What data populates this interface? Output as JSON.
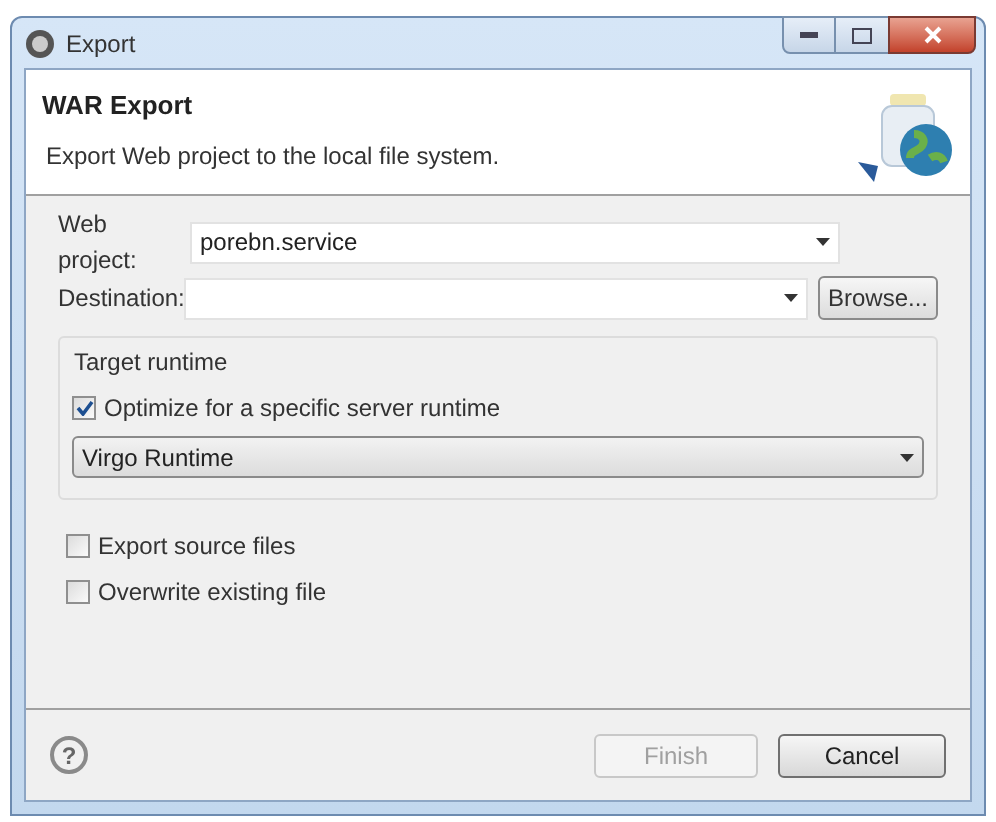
{
  "window": {
    "title": "Export"
  },
  "header": {
    "title": "WAR Export",
    "description": "Export Web project to the local file system."
  },
  "fields": [
    {
      "label": "Web project:",
      "value": "porebn.service"
    },
    {
      "label": "Destination:",
      "button": "Browse..."
    }
  ],
  "target_runtime": {
    "title": "Target runtime",
    "optimize": {
      "label": "Optimize for a specific server runtime",
      "checked": true
    },
    "runtime": "Virgo Runtime"
  },
  "options": [
    {
      "label": "Export source files",
      "checked": false
    },
    {
      "label": "Overwrite existing file",
      "checked": false
    }
  ],
  "help": "?",
  "buttons": [
    {
      "label": "Finish",
      "disabled": true
    },
    {
      "label": "Cancel",
      "disabled": false
    }
  ]
}
